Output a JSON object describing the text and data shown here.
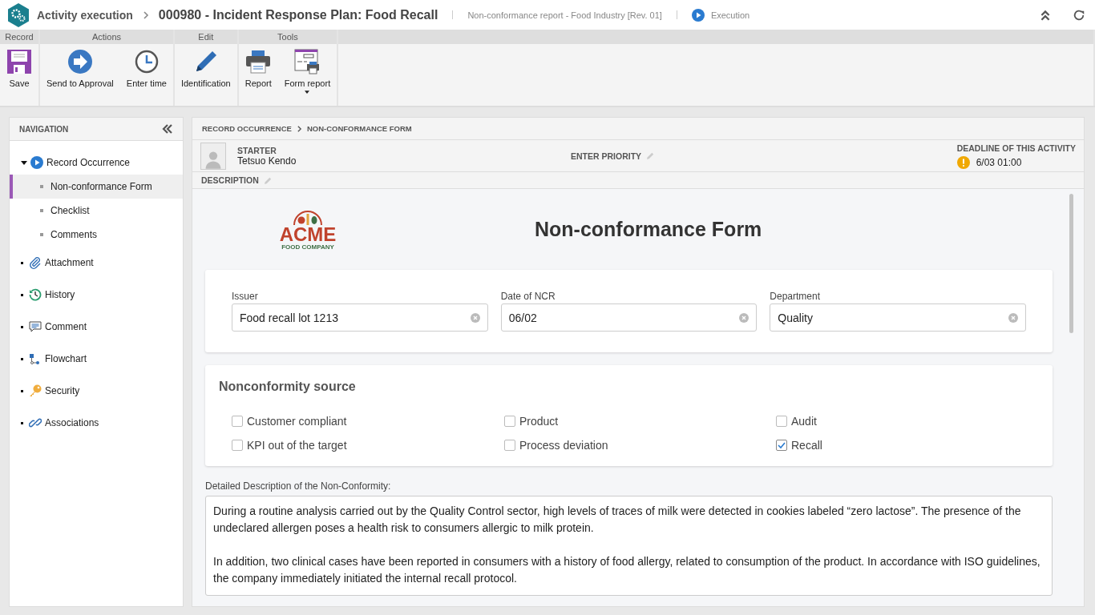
{
  "header": {
    "module": "Activity execution",
    "title": "000980 - Incident Response Plan: Food Recall",
    "subtitle": "Non-conformance report - Food Industry [Rev. 01]",
    "status": "Execution"
  },
  "ribbon": [
    {
      "group": "Record",
      "buttons": [
        {
          "label": "Save",
          "dropdown": false
        }
      ]
    },
    {
      "group": "Actions",
      "buttons": [
        {
          "label": "Send to Approval",
          "dropdown": false
        },
        {
          "label": "Enter time",
          "dropdown": false
        }
      ]
    },
    {
      "group": "Edit",
      "buttons": [
        {
          "label": "Identification",
          "dropdown": false
        }
      ]
    },
    {
      "group": "Tools",
      "buttons": [
        {
          "label": "Report",
          "dropdown": false
        },
        {
          "label": "Form report",
          "dropdown": true
        }
      ]
    }
  ],
  "navigation": {
    "title": "NAVIGATION",
    "items": [
      {
        "label": "Record Occurrence",
        "expanded": true,
        "children": [
          {
            "label": "Non-conformance Form",
            "selected": true
          },
          {
            "label": "Checklist",
            "selected": false
          },
          {
            "label": "Comments",
            "selected": false
          }
        ]
      },
      {
        "label": "Attachment"
      },
      {
        "label": "History"
      },
      {
        "label": "Comment"
      },
      {
        "label": "Flowchart"
      },
      {
        "label": "Security"
      },
      {
        "label": "Associations"
      }
    ]
  },
  "breadcrumb": [
    "RECORD OCCURRENCE",
    "NON-CONFORMANCE FORM"
  ],
  "info": {
    "starter_label": "STARTER",
    "starter": "Tetsuo Kendo",
    "priority_label": "ENTER PRIORITY",
    "deadline_label": "DEADLINE OF THIS ACTIVITY",
    "deadline": "6/03 01:00",
    "description_label": "DESCRIPTION"
  },
  "form": {
    "logo": {
      "name": "ACME",
      "tagline": "FOOD COMPANY"
    },
    "title": "Non-conformance Form",
    "fields": [
      {
        "label": "Issuer",
        "value": "Food recall lot 1213"
      },
      {
        "label": "Date of NCR",
        "value": "06/02"
      },
      {
        "label": "Department",
        "value": "Quality"
      }
    ],
    "source": {
      "title": "Nonconformity source",
      "options": [
        {
          "label": "Customer compliant",
          "checked": false
        },
        {
          "label": "Product",
          "checked": false
        },
        {
          "label": "Audit",
          "checked": false
        },
        {
          "label": "KPI out of the target",
          "checked": false
        },
        {
          "label": "Process deviation",
          "checked": false
        },
        {
          "label": "Recall",
          "checked": true
        }
      ]
    },
    "description": {
      "label": "Detailed Description of the Non-Conformity:",
      "value": "During a routine analysis carried out by the Quality Control sector, high levels of traces of milk were detected in cookies labeled “zero lactose”. The presence of the undeclared allergen poses a health risk to consumers allergic to milk protein.\n\nIn addition, two clinical cases have been reported in consumers with a history of food allergy, related to consumption of the product. In accordance with ISO guidelines, the company immediately initiated the internal recall protocol."
    }
  }
}
